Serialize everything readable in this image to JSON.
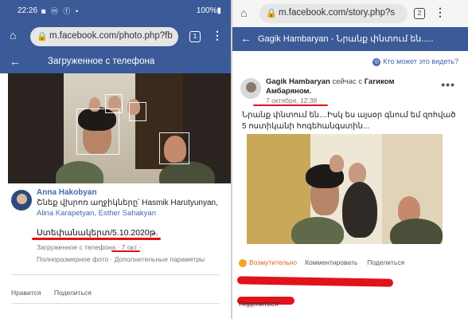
{
  "left": {
    "status": {
      "time": "22:26",
      "icons_left": "◙ ⓜ ⓕ •",
      "icons_right": "100%▮"
    },
    "url": "m.facebook.com/photo.php?fb",
    "tab_count": "1",
    "header_title": "Загруженное с телефона",
    "post": {
      "author": "Anna Hakobyan",
      "caption": "Շնեք վխրոռ աղջիկները՛ Hasmik Harutyunyan,",
      "tagged": "Alina Karapetyan, Esther Sahakyan",
      "date_text": "Ստեփանակերտ/5.10.2020թ.",
      "meta": "Загруженное с телефона · 7 окт ·",
      "links": "Полноразмерное фото · Дополнительные параметры",
      "actions": [
        "Нравится",
        "Поделиться"
      ]
    }
  },
  "right": {
    "url": "m.facebook.com/story.php?s",
    "tab_count": "2",
    "header_title": "Gagik Hambaryan - Նրանք փնտում են.....",
    "who_can_see": "Кто может это видеть?",
    "post": {
      "author": "Gagik Hambaryan",
      "with_text": "сейчас с",
      "tagged": "Гагиком",
      "tagged2": "Амбаряном.",
      "time": "7 октября, 12:38 ·",
      "text": "Նրանք փնտում են…Իսկ ես այսօր գնում եմ զոհված 5 ոստիկանի հոգեհանգստին...",
      "reaction_word": "Возмутительно",
      "actions": [
        "Комментировать",
        "Поделиться"
      ],
      "share_partial": "Поделиться"
    }
  },
  "colors": {
    "fb_blue": "#3b5a98",
    "link_blue": "#4267b2",
    "red_marker": "#e0121b"
  }
}
